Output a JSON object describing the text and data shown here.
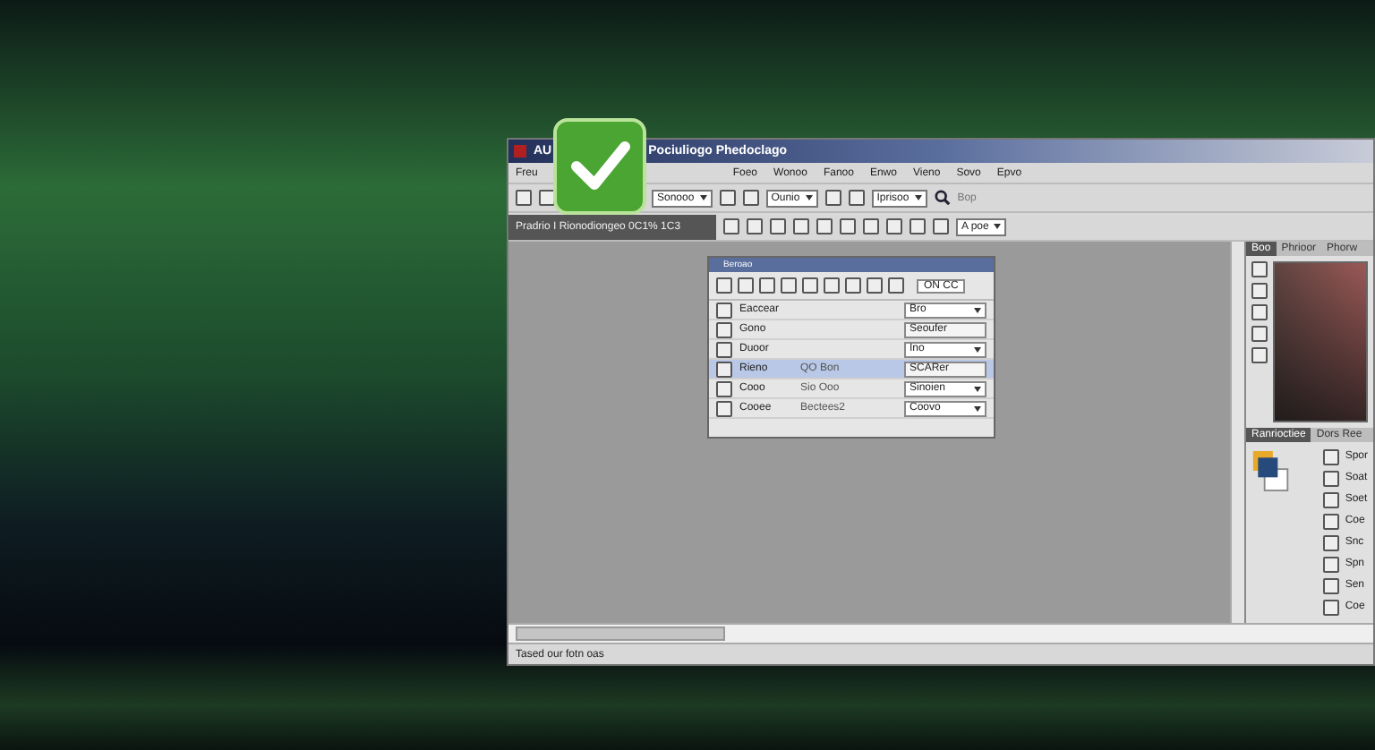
{
  "window": {
    "app_mark": "AU",
    "title": "Pociuliogo Phedoclago"
  },
  "menu": [
    "Freu",
    "Foeo",
    "Wonoo",
    "Fanoo",
    "Enwo",
    "Vieno",
    "Sovo",
    "Epvo"
  ],
  "toolbar": {
    "dropdowns": [
      "Sonooo",
      "Ounio",
      "Iprisoo"
    ],
    "search_text": "Bop"
  },
  "document_tab": {
    "label": "Pradrio I Rionodiongeo 0C1% 1C3",
    "dropdown": "A poe"
  },
  "dialog": {
    "title": "Beroao",
    "field": "ON CC",
    "rows": [
      {
        "label": "Eaccear",
        "middle": "",
        "value": "Bro",
        "kind": "dropdown",
        "selected": false
      },
      {
        "label": "Gono",
        "middle": "",
        "value": "Seoufer",
        "kind": "field",
        "selected": false
      },
      {
        "label": "Duoor",
        "middle": "",
        "value": "Ino",
        "kind": "dropdown",
        "selected": false
      },
      {
        "label": "Rieno",
        "middle": "QO Bon",
        "value": "SCARer",
        "kind": "field",
        "selected": true
      },
      {
        "label": "Cooo",
        "middle": "Sio Ooo",
        "value": "Sinoien",
        "kind": "dropdown",
        "selected": false
      },
      {
        "label": "Cooee",
        "middle": "Bectees2",
        "value": "Coovo",
        "kind": "dropdown",
        "selected": false
      }
    ]
  },
  "right_panel": {
    "tabs": [
      {
        "label": "Boo",
        "selected": true
      },
      {
        "label": "Phrioor",
        "selected": false
      },
      {
        "label": "Phorw",
        "selected": false
      }
    ],
    "lower_tabs": [
      {
        "label": "Ranrioctiee",
        "selected": true
      },
      {
        "label": "Dors Ree",
        "selected": false
      }
    ],
    "tools": [
      "Spor",
      "Soat",
      "Soet",
      "Coe",
      "Snc",
      "Spn",
      "Sen",
      "Coe"
    ]
  },
  "status_bar": "Tased our fotn oas"
}
